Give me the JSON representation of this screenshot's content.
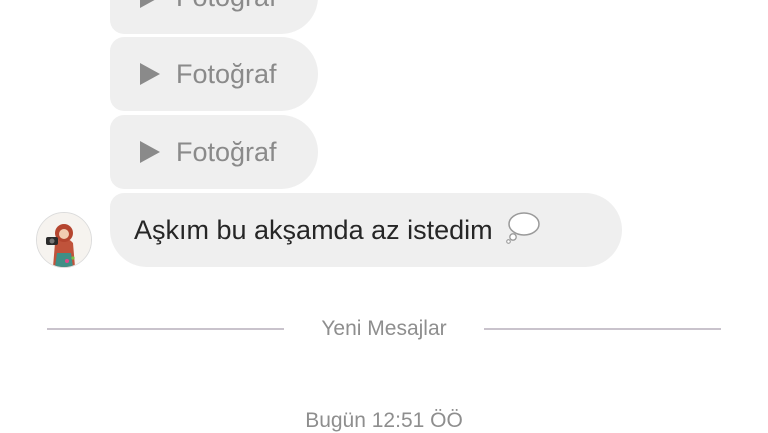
{
  "thread": {
    "messages": [
      {
        "type": "photo",
        "label": "Fotoğraf"
      },
      {
        "type": "photo",
        "label": "Fotoğraf"
      },
      {
        "type": "photo",
        "label": "Fotoğraf"
      },
      {
        "type": "text",
        "text": "Aşkım bu akşamda az istedim"
      }
    ],
    "new_messages_label": "Yeni Mesajlar",
    "timestamp": "Bugün 12:51 ÖÖ"
  },
  "icons": {
    "play": "play-icon",
    "thought_bubble": "thought-bubble-emoji"
  },
  "colors": {
    "bubble": "#efefef",
    "text": "#262626",
    "muted": "#8e8e8e",
    "divider": "#c9c3cc"
  }
}
